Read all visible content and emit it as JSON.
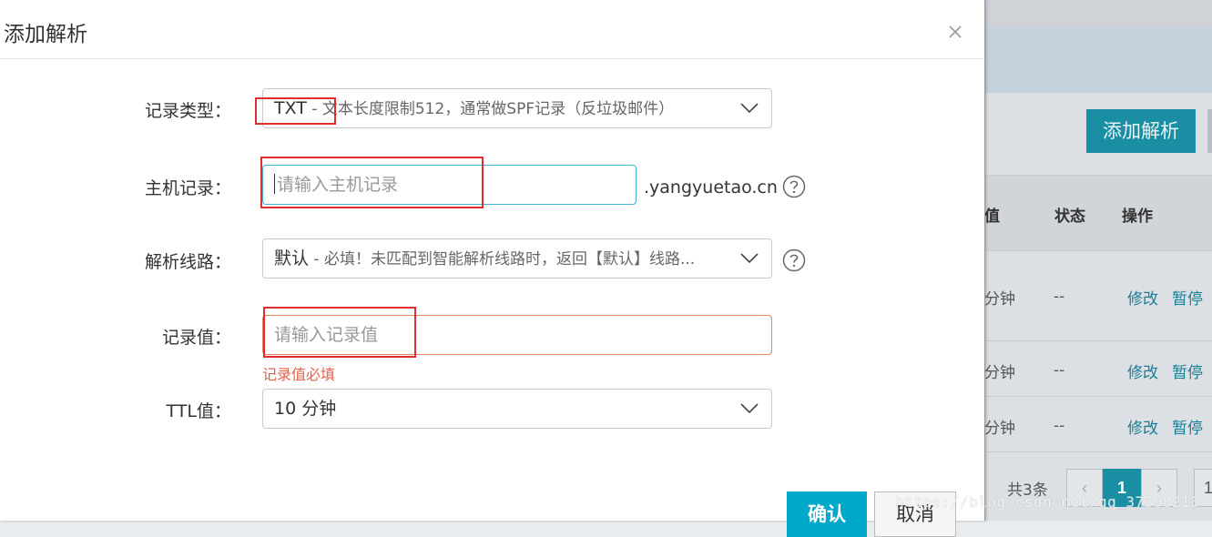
{
  "modal": {
    "title": "添加解析",
    "close_icon": "close-icon",
    "fields": {
      "record_type": {
        "label": "记录类型：",
        "value_main": "TXT",
        "value_sub": " - 文本长度限制512，通常做SPF记录（反垃圾邮件）"
      },
      "host_record": {
        "label": "主机记录：",
        "placeholder": "请输入主机记录",
        "suffix": ".yangyuetao.cn"
      },
      "resolve_line": {
        "label": "解析线路：",
        "value_main": "默认",
        "value_sub": " - 必填！未匹配到智能解析线路时，返回【默认】线路..."
      },
      "record_value": {
        "label": "记录值：",
        "placeholder": "请输入记录值",
        "error": "记录值必填"
      },
      "ttl": {
        "label": "TTL值：",
        "value": "10 分钟"
      }
    },
    "buttons": {
      "confirm": "确认",
      "cancel": "取消"
    }
  },
  "background": {
    "add_button": "添加解析",
    "table_headers": {
      "value": "值",
      "status": "状态",
      "action": "操作"
    },
    "rows": [
      {
        "ttl": "分钟",
        "status": "--",
        "edit": "修改",
        "pause": "暂停"
      },
      {
        "ttl": "分钟",
        "status": "--",
        "edit": "修改",
        "pause": "暂停"
      },
      {
        "ttl": "分钟",
        "status": "--",
        "edit": "修改",
        "pause": "暂停"
      }
    ],
    "pager": {
      "total": "共3条",
      "current_page": "1",
      "prev": "‹",
      "next": "›",
      "next_page": "1"
    }
  },
  "watermark": "https://blog.csdn.net/qq_37398213",
  "colors": {
    "accent": "#00a8cc",
    "error": "#e4604a",
    "annotation": "#e02e2e",
    "link": "#157f97"
  }
}
